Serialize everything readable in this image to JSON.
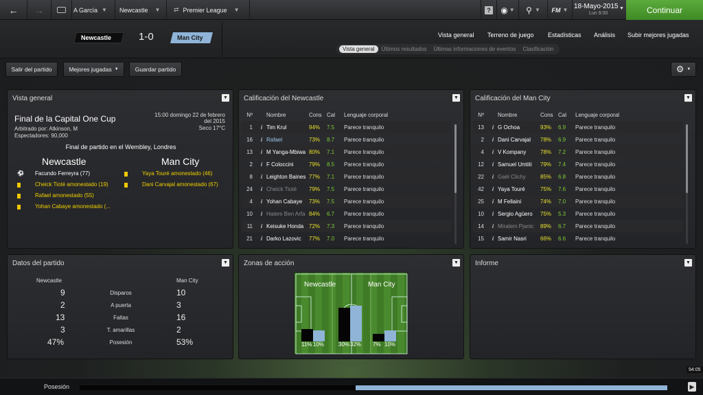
{
  "topbar": {
    "back_icon": "back-arrow-icon",
    "forward_icon": "forward-arrow-icon",
    "manager": "A García",
    "club": "Newcastle",
    "competition": "Premier League",
    "date": "18-Mayo-2015",
    "day_time": "Lun 9:00",
    "continue": "Continuar",
    "help": "?",
    "fm": "FM"
  },
  "match": {
    "home": "Newcastle",
    "away": "Man City",
    "score": "1-0",
    "home_color": "#111111",
    "away_color": "#8fb4d8"
  },
  "nav": {
    "items": [
      "Vista general",
      "Terreno de juego",
      "Estadísticas",
      "Análisis",
      "Subir mejores jugadas"
    ],
    "subtabs": [
      "Vista general",
      "Últimos resultados",
      "Últimas informaciones de eventos",
      "Clasificación"
    ]
  },
  "actions": {
    "leave": "Salir del partido",
    "highlights": "Mejores jugadas",
    "save": "Guardar partido"
  },
  "overview": {
    "title": "Vista general",
    "competition": "Final de la Capital One Cup",
    "referee": "Arbitrado por: Atkinson, M",
    "spectators": "Espectadores: 90,000",
    "datetime": "15:00 domingo 22 de febrero del 2015",
    "weather": "Seco 17°C",
    "venue": "Final de partido en el Wembley, Londres",
    "home": "Newcastle",
    "away": "Man City",
    "home_events": [
      "Facundo Ferreyra (77)",
      "Cheick Tioté amonestado (19)",
      "Rafael amonestado (55)",
      "Yohan Cabaye amonestado (..."
    ],
    "away_events": [
      "Yaya Touré amonestado (46)",
      "Dani Carvajal amonestado (67)"
    ]
  },
  "ratings_headers": [
    "Nº",
    "Nombre",
    "Cons",
    "Cal",
    "Lenguaje corporal"
  ],
  "home_ratings": {
    "title": "Calificación del Newcastle",
    "rows": [
      [
        "1",
        "Tim Krul",
        "94%",
        "7.5",
        "Parece tranquilo"
      ],
      [
        "16",
        "Rafael",
        "73%",
        "8.7",
        "Parece tranquilo"
      ],
      [
        "13",
        "M Yanga-Mbiwa",
        "80%",
        "7.1",
        "Parece tranquilo"
      ],
      [
        "2",
        "F Coloccini",
        "79%",
        "8.5",
        "Parece tranquilo"
      ],
      [
        "8",
        "Leighton Baines",
        "77%",
        "7.1",
        "Parece tranquilo"
      ],
      [
        "24",
        "Cheick Tioté",
        "79%",
        "7.5",
        "Parece tranquilo"
      ],
      [
        "4",
        "Yohan Cabaye",
        "73%",
        "7.5",
        "Parece tranquilo"
      ],
      [
        "10",
        "Hatem Ben Arfa",
        "84%",
        "6.7",
        "Parece tranquilo"
      ],
      [
        "11",
        "Keisuke Honda",
        "72%",
        "7.3",
        "Parece tranquilo"
      ],
      [
        "21",
        "Darko Lazovic",
        "77%",
        "7.0",
        "Parece tranquilo"
      ]
    ]
  },
  "away_ratings": {
    "title": "Calificación del Man City",
    "rows": [
      [
        "13",
        "G Ochoa",
        "93%",
        "6.9",
        "Parece tranquilo"
      ],
      [
        "2",
        "Dani Carvajal",
        "78%",
        "6.9",
        "Parece tranquilo"
      ],
      [
        "4",
        "V Kompany",
        "78%",
        "7.2",
        "Parece tranquilo"
      ],
      [
        "12",
        "Samuel Umtiti",
        "79%",
        "7.4",
        "Parece tranquilo"
      ],
      [
        "22",
        "Gaël Clichy",
        "85%",
        "6.8",
        "Parece tranquilo"
      ],
      [
        "42",
        "Yaya Touré",
        "75%",
        "7.6",
        "Parece tranquilo"
      ],
      [
        "25",
        "M Fellaini",
        "74%",
        "7.0",
        "Parece tranquilo"
      ],
      [
        "10",
        "Sergio Agüero",
        "75%",
        "5.3",
        "Parece tranquilo"
      ],
      [
        "14",
        "Miralem Pjanic",
        "89%",
        "6.7",
        "Parece tranquilo"
      ],
      [
        "15",
        "Samir Nasri",
        "66%",
        "6.6",
        "Parece tranquilo"
      ]
    ]
  },
  "stats": {
    "title": "Datos del partido",
    "home": "Newcastle",
    "away": "Man City",
    "rows": [
      [
        "9",
        "Disparos",
        "10"
      ],
      [
        "2",
        "A puerta",
        "3"
      ],
      [
        "13",
        "Faltas",
        "16"
      ],
      [
        "3",
        "T. amarillas",
        "2"
      ],
      [
        "47%",
        "Posesión",
        "53%"
      ]
    ]
  },
  "zones": {
    "title": "Zonas de acción",
    "home": "Newcastle",
    "away": "Man City",
    "labels": [
      "11%",
      "10%",
      "30%",
      "32%",
      "7%",
      "10%"
    ],
    "home_values": [
      11,
      30,
      7
    ],
    "away_values": [
      10,
      32,
      10
    ]
  },
  "report": {
    "title": "Informe"
  },
  "bottom": {
    "label": "Posesión",
    "clock": "94:05",
    "possession_home": 47
  }
}
